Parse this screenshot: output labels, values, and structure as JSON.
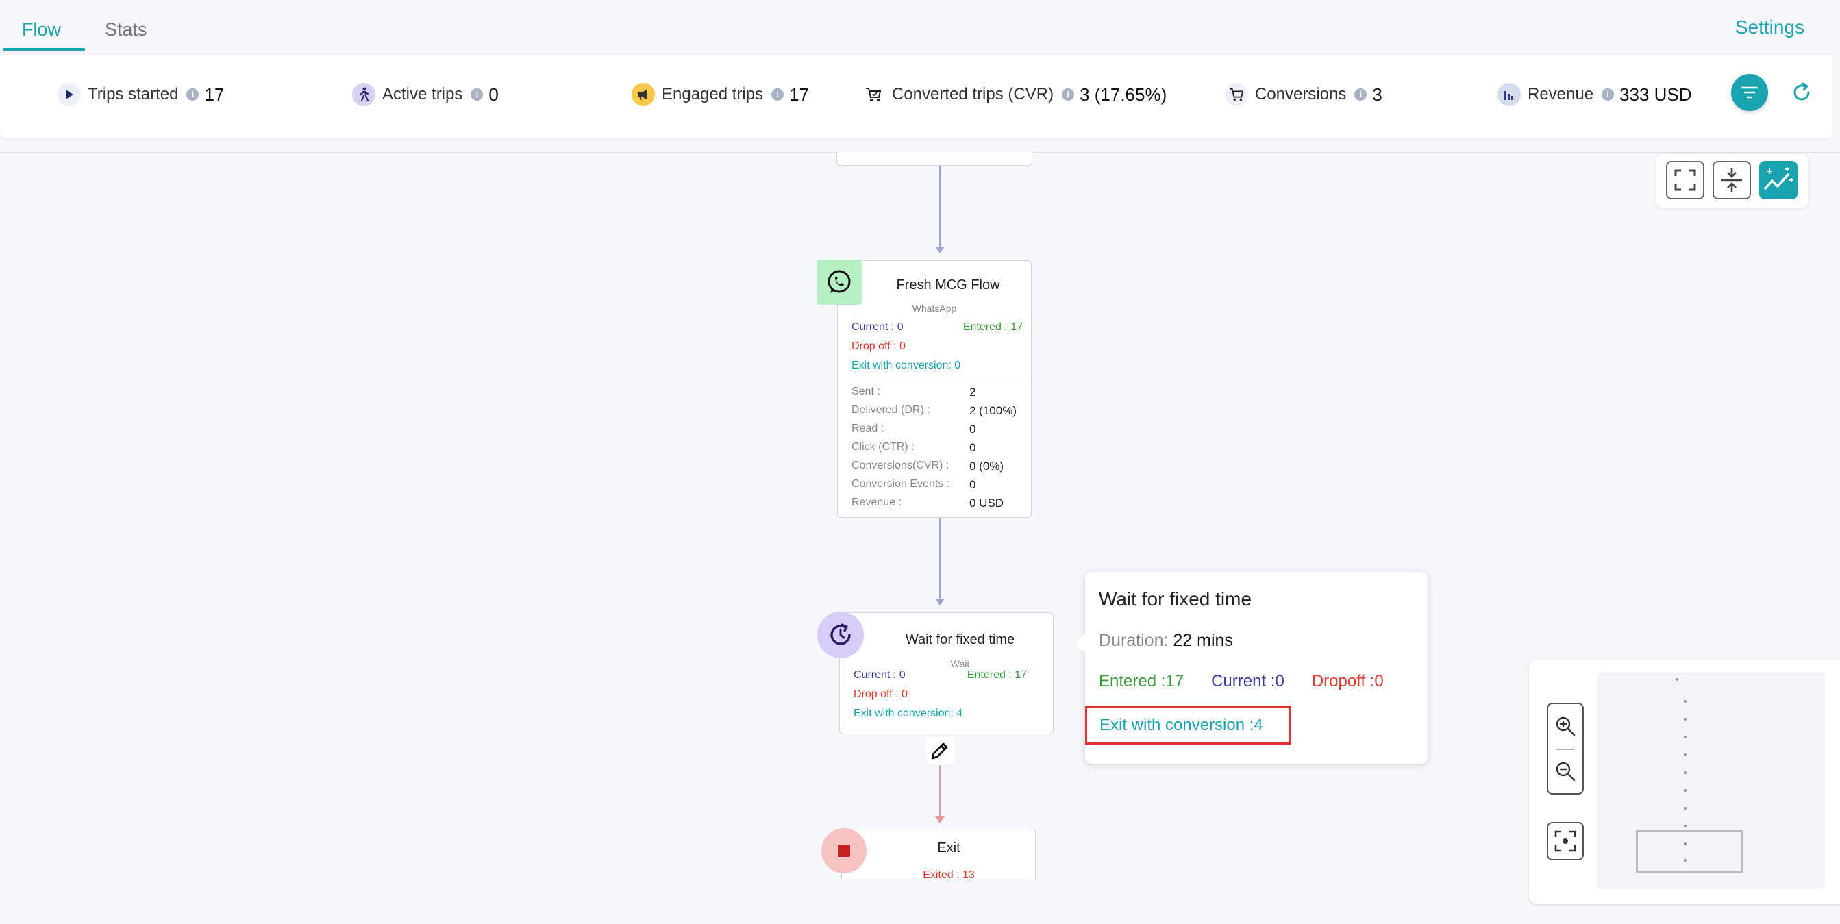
{
  "tabs": {
    "flow": "Flow",
    "stats": "Stats"
  },
  "settings_label": "Settings",
  "stats": {
    "trips_started": {
      "label": "Trips started",
      "value": "17"
    },
    "active_trips": {
      "label": "Active trips",
      "value": "0"
    },
    "engaged_trips": {
      "label": "Engaged trips",
      "value": "17"
    },
    "converted_trips": {
      "label": "Converted trips (CVR)",
      "value": "3 (17.65%)"
    },
    "conversions": {
      "label": "Conversions",
      "value": "3"
    },
    "revenue": {
      "label": "Revenue",
      "value": "333 USD"
    }
  },
  "whatsapp_node": {
    "title": "Fresh MCG Flow",
    "subtitle": "WhatsApp",
    "current": "Current : 0",
    "entered": "Entered : 17",
    "dropoff": "Drop off : 0",
    "exit_conversion": "Exit with conversion: 0",
    "rows": [
      {
        "label": "Sent :",
        "value": "2"
      },
      {
        "label": "Delivered (DR) :",
        "value": "2 (100%)"
      },
      {
        "label": "Read :",
        "value": "0"
      },
      {
        "label": "Click (CTR) :",
        "value": "0"
      },
      {
        "label": "Conversions(CVR) :",
        "value": "0 (0%)"
      },
      {
        "label": "Conversion Events :",
        "value": "0"
      },
      {
        "label": "Revenue :",
        "value": "0  USD"
      }
    ]
  },
  "wait_node": {
    "title": "Wait for fixed time",
    "subtitle": "Wait",
    "current": "Current : 0",
    "entered": "Entered : 17",
    "dropoff": "Drop off : 0",
    "exit_conversion": "Exit with conversion: 4"
  },
  "exit_node": {
    "title": "Exit",
    "exited": "Exited : 13"
  },
  "tooltip": {
    "title": "Wait for fixed time",
    "duration_label": "Duration:",
    "duration_value": "22 mins",
    "entered": "Entered :17",
    "current": "Current :0",
    "dropoff": "Dropoff :0",
    "exit_conversion": "Exit with conversion :4"
  },
  "colors": {
    "accent": "#1aa3b1",
    "current": "#3d3f9e",
    "entered": "#3b9a3b",
    "dropoff": "#e13a2c",
    "highlight": "#e53030"
  }
}
